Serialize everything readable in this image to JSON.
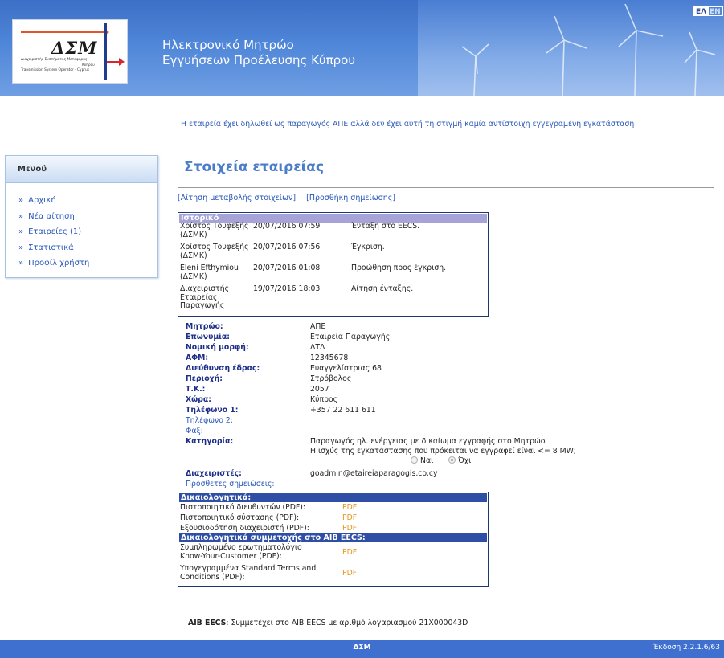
{
  "header": {
    "logo": {
      "title": "ΔΣΜ",
      "line1": "Διαχειριστής Συστήματος Μεταφοράς",
      "line2": "Κύπρου",
      "line3": "Transmission System Operator - Cyprus"
    },
    "site_title_line1": "Ηλεκτρονικό Μητρώο",
    "site_title_line2": "Εγγυήσεων Προέλευσης Κύπρου",
    "lang_el": "ΕΛ",
    "lang_en": "EN"
  },
  "notice": "Η εταιρεία έχει δηλωθεί ως παραγωγός ΑΠΕ αλλά δεν έχει αυτή τη στιγμή καμία αντίστοιχη εγγεγραμένη εγκατάσταση",
  "menu": {
    "title": "Μενού",
    "items": [
      {
        "label": "Αρχική"
      },
      {
        "label": "Νέα αίτηση"
      },
      {
        "label": "Εταιρείες (1)"
      },
      {
        "label": "Στατιστικά"
      },
      {
        "label": "Προφίλ χρήστη"
      }
    ],
    "chevron": "»"
  },
  "main": {
    "title": "Στοιχεία εταιρείας",
    "actions": [
      {
        "label": "[Αίτηση μεταβολής στοιχείων]"
      },
      {
        "label": "[Προσθήκη σημείωσης]"
      }
    ]
  },
  "history": {
    "header": "Ιστορικό",
    "rows": [
      {
        "who": "Χρίστος Τουφεξής (ΔΣΜΚ)",
        "when": "20/07/2016 07:59",
        "what": "Ένταξη στο EECS."
      },
      {
        "who": "Χρίστος Τουφεξής (ΔΣΜΚ)",
        "when": "20/07/2016 07:56",
        "what": "Έγκριση."
      },
      {
        "who": "Eleni Efthymiou (ΔΣΜΚ)",
        "when": "20/07/2016 01:08",
        "what": "Προώθηση προς έγκριση."
      },
      {
        "who": "Διαχειριστής Εταιρείας Παραγωγής",
        "when": "19/07/2016 18:03",
        "what": "Αίτηση ένταξης."
      }
    ]
  },
  "fields": {
    "registry": {
      "label": "Μητρώο:",
      "value": "ΑΠΕ"
    },
    "name": {
      "label": "Επωνυμία:",
      "value": "Εταιρεία Παραγωγής"
    },
    "legal_form": {
      "label": "Νομική μορφή:",
      "value": "ΛΤΔ"
    },
    "tin": {
      "label": "ΑΦΜ:",
      "value": "12345678"
    },
    "address": {
      "label": "Διεύθυνση έδρας:",
      "value": "Ευαγγελίστριας 68"
    },
    "area": {
      "label": "Περιοχή:",
      "value": "Στρόβολος"
    },
    "postcode": {
      "label": "Τ.Κ.:",
      "value": "2057"
    },
    "country": {
      "label": "Χώρα:",
      "value": "Κύπρος"
    },
    "phone1": {
      "label": "Τηλέφωνο 1:",
      "value": "+357 22 611 611"
    },
    "phone2": {
      "label": "Τηλέφωνο 2:",
      "value": ""
    },
    "fax": {
      "label": "Φαξ:",
      "value": ""
    },
    "category": {
      "label": "Κατηγορία:",
      "value": "Παραγωγός ηλ. ενέργειας με δικαίωμα εγγραφής στο Μητρώο",
      "question": "Η ισχύς της εγκατάστασης που πρόκειται να εγγραφεί είναι <= 8 MW;",
      "option_yes": "Ναι",
      "option_no": "Όχι",
      "selected": "Όχι"
    },
    "admins": {
      "label": "Διαχειριστές:",
      "value": "goadmin@etaireiaparagogis.co.cy"
    },
    "notes": {
      "label": "Πρόσθετες σημειώσεις:",
      "value": ""
    }
  },
  "docs": {
    "header": "Δικαιολογητικά:",
    "rows": [
      {
        "label": "Πιστοποιητικό διευθυντών (PDF):",
        "link": "PDF"
      },
      {
        "label": "Πιστοποιητικό σύστασης (PDF):",
        "link": "PDF"
      },
      {
        "label": "Εξουσιοδότηση διαχειριστή (PDF):",
        "link": "PDF"
      }
    ],
    "aib_header": "Δικαιολογητικά συμμετοχής στο AIB EECS:",
    "aib_rows": [
      {
        "label": "Συμπληρωμένο ερωτηματολόγιο Know-Your-Customer (PDF):",
        "link": "PDF"
      },
      {
        "label": "Υπογεγραμμένα Standard Terms and Conditions (PDF):",
        "link": "PDF"
      }
    ]
  },
  "aib": {
    "label": "AIB EECS",
    "text": ": Συμμετέχει στο AIB EECS με αριθμό λογαριασμού 21X000043D"
  },
  "footer": {
    "center": "ΔΣΜ",
    "version": "Έκδοση 2.2.1.6/63"
  },
  "colors": {
    "header_blue": "#4f86d8",
    "link_blue": "#2a58b8",
    "label_navy": "#1e2f8a",
    "title_blue": "#4a7cc8",
    "pdf_orange": "#e6941c",
    "footer_blue": "#3f6fcf"
  }
}
